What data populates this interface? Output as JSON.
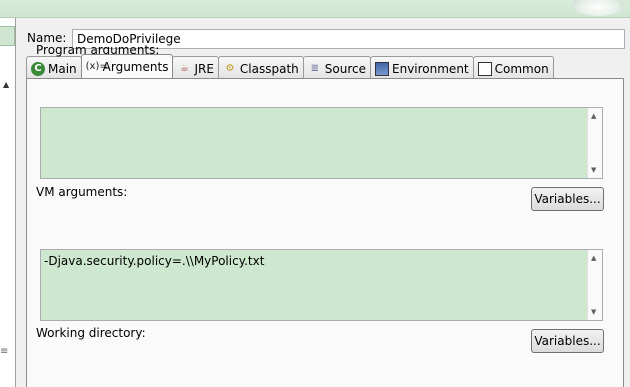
{
  "name_field": {
    "label": "Name:",
    "value": "DemoDoPrivilege"
  },
  "tabs": [
    {
      "label": "Main",
      "icon": "main-icon"
    },
    {
      "label": "Arguments",
      "icon": "arguments-icon",
      "icon_text": "(x)=",
      "active": true
    },
    {
      "label": "JRE",
      "icon": "jre-icon"
    },
    {
      "label": "Classpath",
      "icon": "classpath-icon"
    },
    {
      "label": "Source",
      "icon": "source-icon"
    },
    {
      "label": "Environment",
      "icon": "environment-icon"
    },
    {
      "label": "Common",
      "icon": "common-icon"
    }
  ],
  "program_arguments": {
    "title": "Program arguments:",
    "value": "",
    "variables_button": "Variables..."
  },
  "vm_arguments": {
    "title": "VM arguments:",
    "value": "-Djava.security.policy=.\\\\MyPolicy.txt",
    "variables_button": "Variables..."
  },
  "working_directory": {
    "title": "Working directory:"
  },
  "colors": {
    "text_area_bg": "#cde8cf",
    "top_strip": "#d9ecdb"
  }
}
